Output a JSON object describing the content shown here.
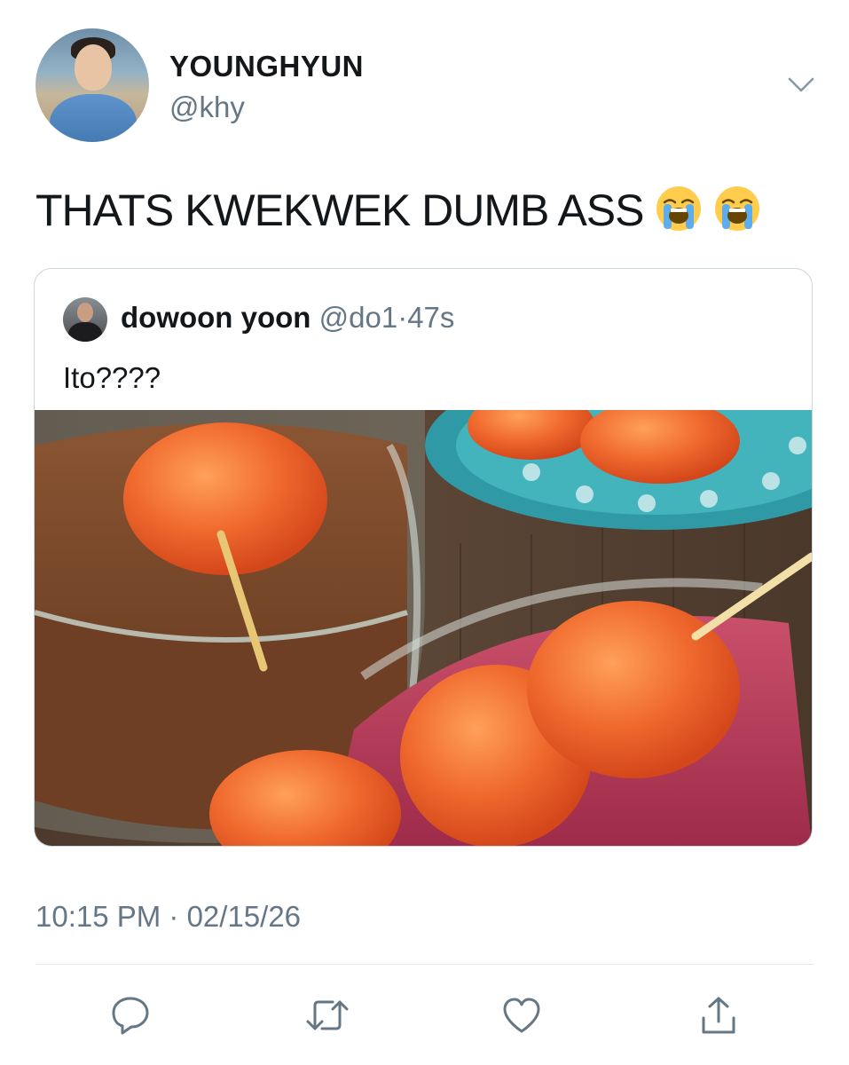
{
  "tweet": {
    "author": {
      "display_name": "YOUNGHYUN",
      "handle": "@khy"
    },
    "text": "THATS KWEKWEK DUMB ASS",
    "emoji": [
      "loudly-crying-face",
      "loudly-crying-face"
    ],
    "timestamp": "10:15 PM · 02/15/26"
  },
  "quoted_tweet": {
    "display_name": "dowoon yoon",
    "handle": "@do1",
    "separator": "·",
    "age": "47s",
    "text": "Ito????",
    "media": "kwek-kwek-photo"
  },
  "actions": {
    "reply": "reply-icon",
    "retweet": "retweet-icon",
    "like": "heart-icon",
    "share": "share-icon"
  },
  "colors": {
    "text": "#14171a",
    "secondary": "#657786",
    "border": "#ccd6dd",
    "divider": "#e1e8ed"
  }
}
